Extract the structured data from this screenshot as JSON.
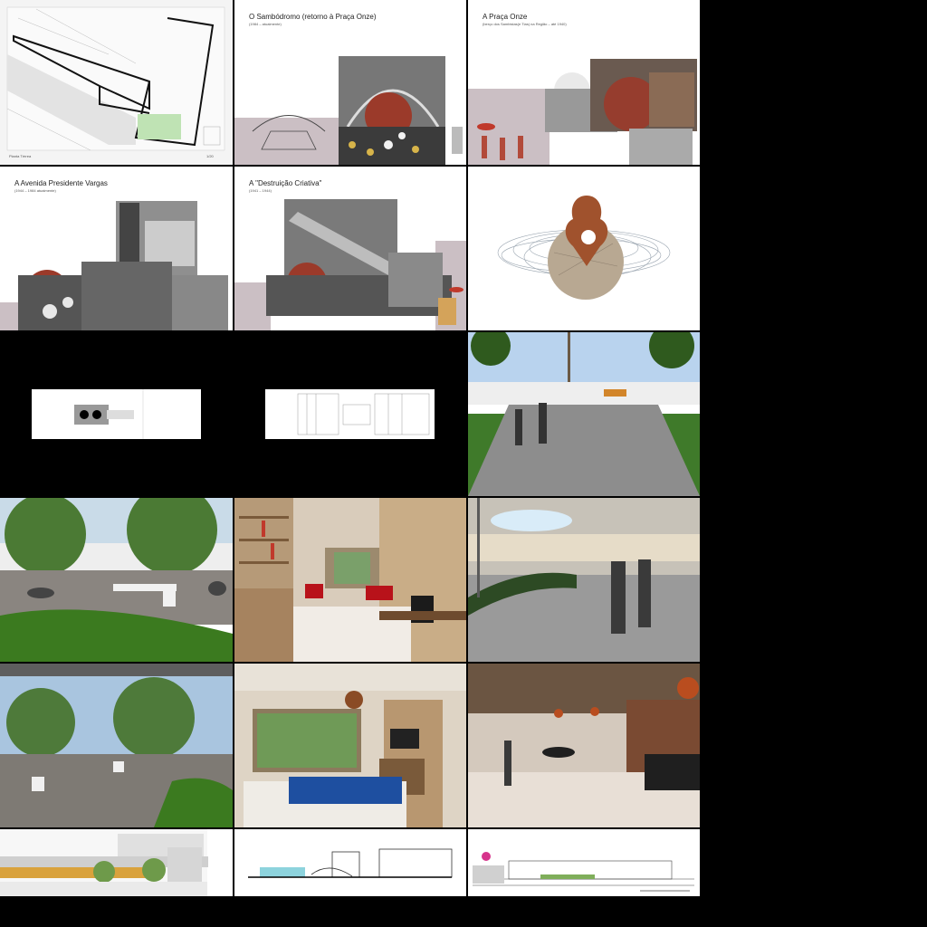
{
  "grid": {
    "background": "#000000",
    "columns": 3,
    "rows": 6
  },
  "tiles": {
    "floor_plan": {
      "caption": "Planta Térrea",
      "page_no": "1/20"
    },
    "sambodromo": {
      "title": "O Sambódromo (retorno à Praça Onze)",
      "subtitle": "(1984 – atualmente)"
    },
    "praca_onze": {
      "title": "A Praça Onze",
      "subtitle": "(berço dos Sambistas(e Tias) na Região – até 1940)"
    },
    "avenida": {
      "title": "A Avenida Presidente Vargas",
      "subtitle": "(1944 – 1984 atualmente)"
    },
    "destruicao": {
      "title": "A \"Destruição Criativa\"",
      "subtitle": "(1941 – 1944)"
    },
    "pin_drawing": {},
    "site_plan_small": {},
    "site_plan_detailed": {},
    "render_courtyard_path": {},
    "render_garden_benches": {},
    "render_library_lounge": {},
    "render_patio_people": {},
    "render_pergola_trees": {},
    "render_bedroom": {},
    "render_hall": {},
    "elevation_colored": {},
    "section_pool": {},
    "elevation_street": {}
  },
  "colors": {
    "accent_red": "#9b3a2a",
    "pin_brown": "#a0522d",
    "grass": "#3f7a2a",
    "sky": "#b9d3ee",
    "paving": "#8d8d8d",
    "plan_gray": "#d9d9d9"
  }
}
